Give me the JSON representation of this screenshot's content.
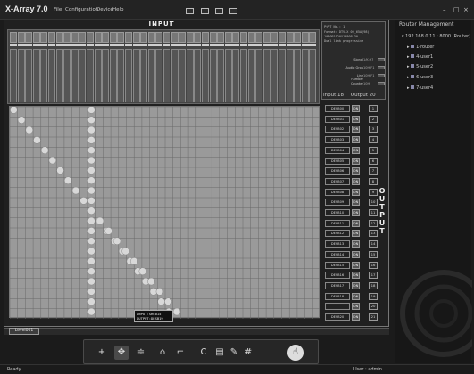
{
  "app": {
    "title": "X-Array 7.0",
    "menu": [
      "File",
      "Configuration",
      "Device",
      "Help"
    ],
    "toolbar_buttons": [
      "layout-1-icon",
      "layout-2-icon",
      "layout-3-icon",
      "layout-4-icon"
    ],
    "window_controls": [
      "minimize-icon",
      "maximize-icon",
      "close-icon"
    ]
  },
  "input_panel": {
    "title": "INPUT",
    "input_count": "Input 18",
    "output_count": "Output 20"
  },
  "signal_info": {
    "lines": [
      "PtPT No.: 1",
      "Format: DTV-X 09_65A(98)",
      "  1080P1920X1080P 30",
      "  Dual link progressive"
    ],
    "signals": [
      {
        "label": "Signal",
        "value": "1/K:97",
        "led": "on"
      },
      {
        "label": "Audio Grou",
        "value": "10H:F1",
        "led": "on"
      },
      {
        "label": "Line number",
        "value": "10H:F1",
        "led": "on"
      },
      {
        "label": "Counter",
        "value": "10H",
        "led": "on"
      }
    ]
  },
  "outputs": {
    "label": "OUTPUT",
    "rows": [
      {
        "name": "DESB00",
        "state": "ON",
        "num": "1"
      },
      {
        "name": "DESB01",
        "state": "ON",
        "num": "2"
      },
      {
        "name": "DESB02",
        "state": "ON",
        "num": "3"
      },
      {
        "name": "DESB03",
        "state": "ON",
        "num": "4"
      },
      {
        "name": "DESB04",
        "state": "ON",
        "num": "5"
      },
      {
        "name": "DESB05",
        "state": "ON",
        "num": "6"
      },
      {
        "name": "DESB06",
        "state": "ON",
        "num": "7"
      },
      {
        "name": "DESB07",
        "state": "ON",
        "num": "8"
      },
      {
        "name": "DESB08",
        "state": "ON",
        "num": "9"
      },
      {
        "name": "DESB09",
        "state": "ON",
        "num": "10"
      },
      {
        "name": "DESB10",
        "state": "ON",
        "num": "11"
      },
      {
        "name": "DESB11",
        "state": "ON",
        "num": "12"
      },
      {
        "name": "DESB12",
        "state": "ON",
        "num": "13"
      },
      {
        "name": "DESB13",
        "state": "ON",
        "num": "14"
      },
      {
        "name": "DESB14",
        "state": "ON",
        "num": "15"
      },
      {
        "name": "DESB15",
        "state": "ON",
        "num": "16"
      },
      {
        "name": "DESB16",
        "state": "ON",
        "num": "17"
      },
      {
        "name": "DESB17",
        "state": "ON",
        "num": "18"
      },
      {
        "name": "DESB18",
        "state": "ON",
        "num": "19"
      },
      {
        "name": "",
        "state": "ON",
        "num": "20"
      },
      {
        "name": "DESB20",
        "state": "ON",
        "num": "21"
      }
    ]
  },
  "tooltip": {
    "input": "INPUT:SRC015",
    "output": "OUTPUT:DESB19"
  },
  "tabs": {
    "active": "Level001"
  },
  "bottom_tools": [
    "add-icon",
    "move-icon",
    "align-icon",
    "lock-icon",
    "unlock-icon",
    "copy-icon",
    "paste-icon",
    "edit-icon",
    "grid-icon",
    "touch-icon"
  ],
  "status": {
    "left": "Ready",
    "right": "User : admin"
  },
  "router_management": {
    "title": "Router Management",
    "root": "192.168.0.11 : 8000 (Router)",
    "items": [
      "1-router",
      "4-user1",
      "5-user2",
      "6-user3",
      "7-user4"
    ]
  },
  "colors": {
    "background": "#1b1b1b",
    "grid": "#9a9a9a",
    "crosspoint": "#d8d8d8"
  }
}
